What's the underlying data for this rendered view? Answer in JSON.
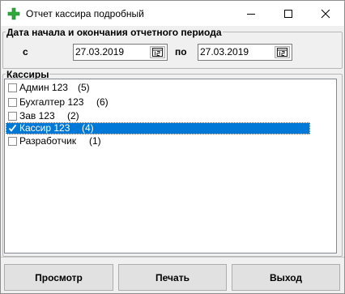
{
  "window": {
    "title": "Отчет кассира подробный",
    "app_icon": "green-plus-icon"
  },
  "period": {
    "caption": "Дата начала и окончания отчетного периода",
    "from_label": "с",
    "from_value": "27.03.2019",
    "to_label": "по",
    "to_value": "27.03.2019",
    "calendar_icon": "calendar-icon"
  },
  "cashiers": {
    "caption": "Кассиры",
    "items": [
      {
        "name": "Админ 123",
        "count": "(5)",
        "checked": false,
        "selected": false
      },
      {
        "name": "Бухгалтер 123",
        "count": "(6)",
        "checked": false,
        "selected": false
      },
      {
        "name": "Зав 123",
        "count": "(2)",
        "checked": false,
        "selected": false
      },
      {
        "name": "Кассир 123",
        "count": "(4)",
        "checked": true,
        "selected": true
      },
      {
        "name": "Разработчик",
        "count": "(1)",
        "checked": false,
        "selected": false
      }
    ]
  },
  "buttons": {
    "preview": "Просмотр",
    "print": "Печать",
    "exit": "Выход"
  },
  "colors": {
    "selection": "#0078d7",
    "app_icon_green": "#2eaa3a"
  }
}
